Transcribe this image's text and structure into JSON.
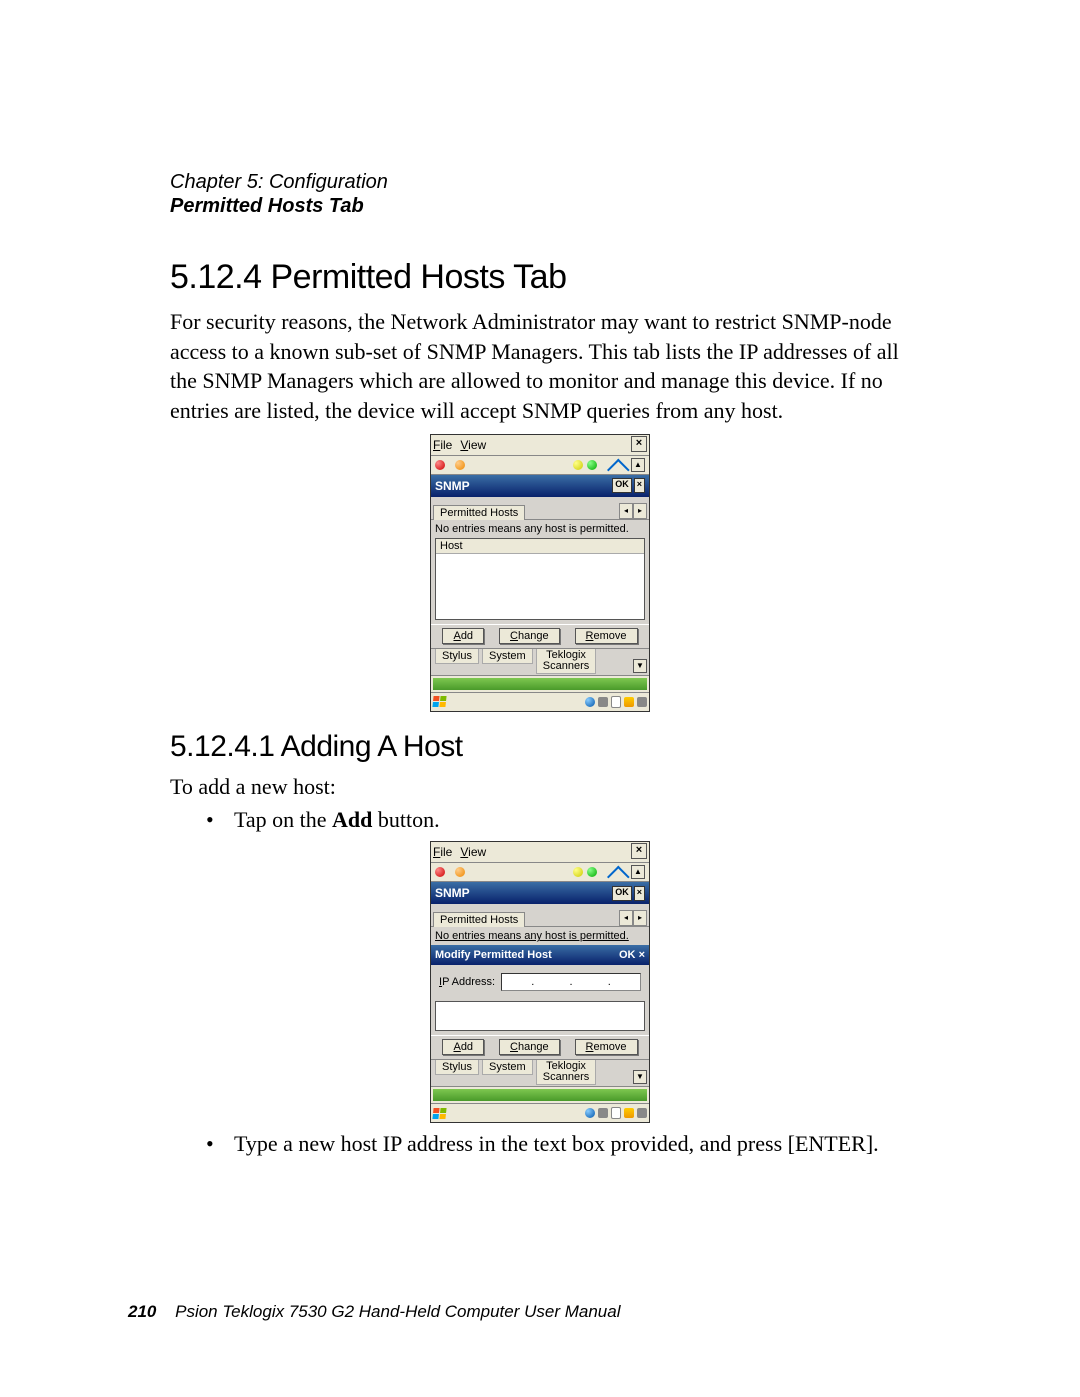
{
  "header": {
    "chapter": "Chapter 5: Configuration",
    "section": "Permitted Hosts Tab"
  },
  "s1": {
    "num": "5.12.4",
    "title": "Permitted Hosts Tab",
    "para": "For security reasons, the Network Administrator may want to restrict SNMP-node access to a known sub-set of SNMP Managers. This tab lists the IP addresses of all the SNMP Managers which are allowed to monitor and manage this device. If no entries are listed, the device will accept SNMP queries from any host."
  },
  "shot1": {
    "menu_file_u": "F",
    "menu_file_r": "ile",
    "menu_view_u": "V",
    "menu_view_r": "iew",
    "close_x": "×",
    "title": "SNMP",
    "ok": "OK",
    "tb_x": "×",
    "tab": "Permitted Hosts",
    "info": "No entries means any host is permitted.",
    "col_host": "Host",
    "btn_add_u": "A",
    "btn_add_r": "dd",
    "btn_change_u": "C",
    "btn_change_r": "hange",
    "btn_remove_u": "R",
    "btn_remove_r": "emove",
    "bt1": "Stylus",
    "bt2": "System",
    "bt3_l1": "Teklogix",
    "bt3_l2": "Scanners",
    "scroll_up": "▲",
    "tab_left": "◂",
    "tab_right": "▸",
    "scroll_down": "▼"
  },
  "s2": {
    "num": "5.12.4.1",
    "title": "Adding A Host",
    "intro": "To add a new host:",
    "b1_pre": "Tap on the ",
    "b1_bold": "Add",
    "b1_post": " button.",
    "b2": "Type a new host IP address in the text box provided, and press [ENTER]."
  },
  "shot2": {
    "modify_title": "Modify Permitted Host",
    "ip_u": "I",
    "ip_r": "P Address:",
    "dot": "."
  },
  "footer": {
    "page": "210",
    "text": "Psion Teklogix 7530 G2 Hand-Held Computer User Manual"
  }
}
